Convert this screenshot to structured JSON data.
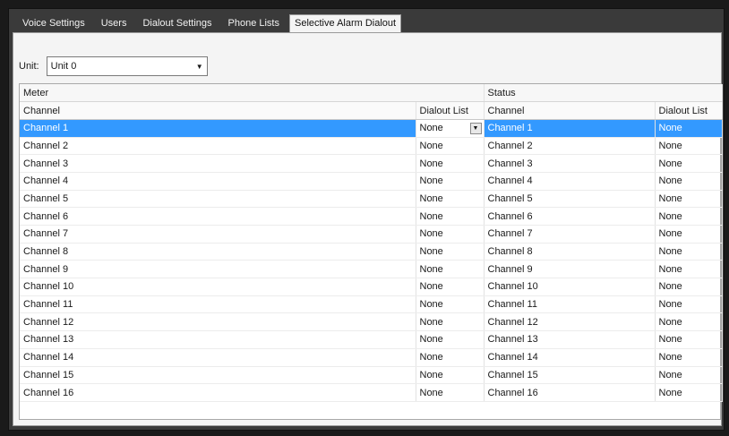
{
  "tabs": [
    "Voice Settings",
    "Users",
    "Dialout Settings",
    "Phone Lists",
    "Selective Alarm Dialout"
  ],
  "unit": {
    "label": "Unit:",
    "value": "Unit 0"
  },
  "grid": {
    "group_headers": {
      "meter": "Meter",
      "status": "Status"
    },
    "columns": {
      "channel": "Channel",
      "dialout": "Dialout List"
    },
    "rows": [
      {
        "meter_channel": "Channel 1",
        "meter_dialout": "None",
        "status_channel": "Channel 1",
        "status_dialout": "None"
      },
      {
        "meter_channel": "Channel 2",
        "meter_dialout": "None",
        "status_channel": "Channel 2",
        "status_dialout": "None"
      },
      {
        "meter_channel": "Channel 3",
        "meter_dialout": "None",
        "status_channel": "Channel 3",
        "status_dialout": "None"
      },
      {
        "meter_channel": "Channel 4",
        "meter_dialout": "None",
        "status_channel": "Channel 4",
        "status_dialout": "None"
      },
      {
        "meter_channel": "Channel 5",
        "meter_dialout": "None",
        "status_channel": "Channel 5",
        "status_dialout": "None"
      },
      {
        "meter_channel": "Channel 6",
        "meter_dialout": "None",
        "status_channel": "Channel 6",
        "status_dialout": "None"
      },
      {
        "meter_channel": "Channel 7",
        "meter_dialout": "None",
        "status_channel": "Channel 7",
        "status_dialout": "None"
      },
      {
        "meter_channel": "Channel 8",
        "meter_dialout": "None",
        "status_channel": "Channel 8",
        "status_dialout": "None"
      },
      {
        "meter_channel": "Channel 9",
        "meter_dialout": "None",
        "status_channel": "Channel 9",
        "status_dialout": "None"
      },
      {
        "meter_channel": "Channel 10",
        "meter_dialout": "None",
        "status_channel": "Channel 10",
        "status_dialout": "None"
      },
      {
        "meter_channel": "Channel 11",
        "meter_dialout": "None",
        "status_channel": "Channel 11",
        "status_dialout": "None"
      },
      {
        "meter_channel": "Channel 12",
        "meter_dialout": "None",
        "status_channel": "Channel 12",
        "status_dialout": "None"
      },
      {
        "meter_channel": "Channel 13",
        "meter_dialout": "None",
        "status_channel": "Channel 13",
        "status_dialout": "None"
      },
      {
        "meter_channel": "Channel 14",
        "meter_dialout": "None",
        "status_channel": "Channel 14",
        "status_dialout": "None"
      },
      {
        "meter_channel": "Channel 15",
        "meter_dialout": "None",
        "status_channel": "Channel 15",
        "status_dialout": "None"
      },
      {
        "meter_channel": "Channel 16",
        "meter_dialout": "None",
        "status_channel": "Channel 16",
        "status_dialout": "None"
      }
    ]
  },
  "colors": {
    "selection": "#3399ff",
    "frame": "#3a3a3a",
    "panel": "#f4f4f4"
  },
  "icons": {
    "unit_dropdown": "chevron-down-icon",
    "cell_dropdown": "chevron-down-icon"
  }
}
